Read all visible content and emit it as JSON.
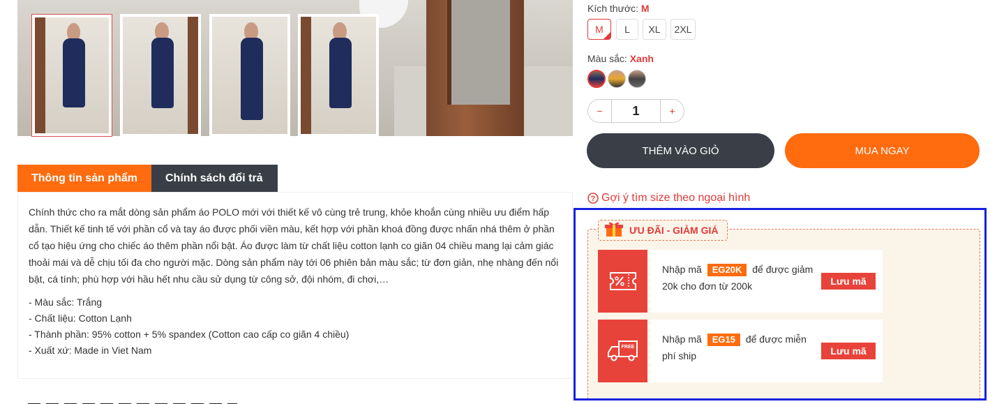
{
  "gallery": {
    "thumbnails": [
      "thumb-1",
      "thumb-2",
      "thumb-3",
      "thumb-4"
    ]
  },
  "size": {
    "label": "Kích thước:",
    "selected": "M",
    "options": [
      "M",
      "L",
      "XL",
      "2XL"
    ]
  },
  "color": {
    "label": "Màu sắc:",
    "selected": "Xanh"
  },
  "quantity": {
    "minus": "−",
    "value": "1",
    "plus": "+"
  },
  "actions": {
    "add_to_cart": "THÊM VÀO GIỎ",
    "buy_now": "MUA NGAY"
  },
  "size_guide": {
    "icon": "question-circle-icon",
    "text": "Gợi ý tìm size theo ngoại hình"
  },
  "tabs": [
    {
      "label": "Thông tin sản phẩm"
    },
    {
      "label": "Chính sách đổi trả"
    }
  ],
  "description": {
    "paragraph": "Chính thức cho ra mắt dòng sản phẩm áo POLO mới với thiết kế vô cùng trẻ trung, khỏe khoắn cùng nhiều ưu điểm hấp dẫn. Thiết kế tinh tế với phần cổ và tay áo được phối viền màu, kết hợp với phần khoá đồng được nhấn nhá thêm ở phần cổ tạo hiệu ứng cho chiếc áo thêm phần nổi bật. Áo được làm từ chất liệu cotton lạnh co giãn 04 chiều mang lại cảm giác thoải mái và dễ chịu tối đa cho người mặc. Dòng sản phẩm này tới 06 phiên bản màu sắc; từ đơn giản, nhẹ nhàng đến nổi bật, cá tính; phù hợp với hầu hết nhu cầu sử dụng từ công sở, đội nhóm, đi chơi,…",
    "specs": [
      "- Màu sắc: Trắng",
      "- Chất liệu: Cotton Lạnh",
      "- Thành phần: 95% cotton + 5% spandex (Cotton cao cấp co giãn 4 chiều)",
      "- Xuất xứ: Made in Viet Nam"
    ]
  },
  "promo": {
    "title": "ƯU ĐÃI - GIẢM GIÁ",
    "coupons": [
      {
        "icon": "percent-ticket-icon",
        "prefix": "Nhập mã",
        "code": "EG20K",
        "suffix": "để được giảm 20k cho đơn từ 200k",
        "button": "Lưu mã"
      },
      {
        "icon": "free-shipping-truck-icon",
        "prefix": "Nhập mã",
        "code": "EG15",
        "suffix": "để được miễn phí ship",
        "button": "Lưu mã"
      }
    ]
  },
  "colors": {
    "accent": "#ff6b0f",
    "red": "#e03a3a",
    "dark": "#3a3f47",
    "highlight_border": "#1422e0"
  }
}
